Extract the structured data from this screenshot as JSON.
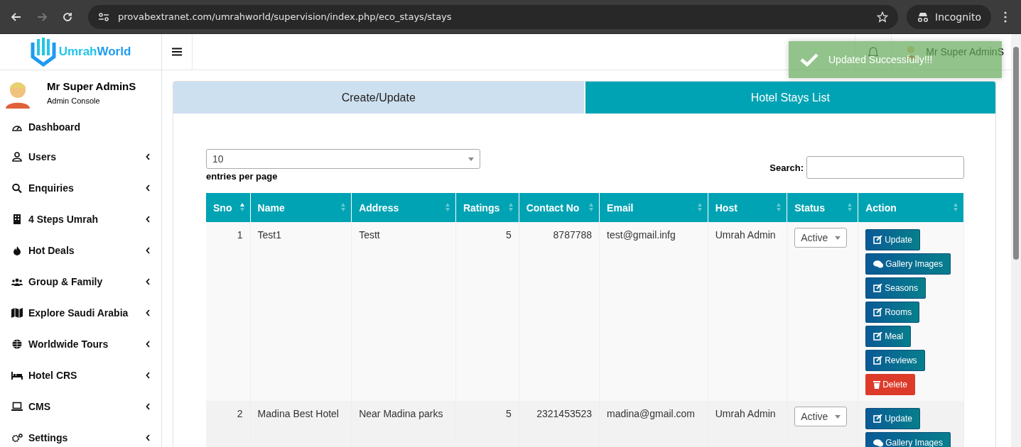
{
  "browser": {
    "url": "provabextranet.com/umrahworld/supervision/index.php/eco_stays/stays",
    "back_disabled": false,
    "forward_disabled": true,
    "profile": "Incognito"
  },
  "logo": {
    "first": "Umrah",
    "second": "World"
  },
  "user": {
    "name": "Mr Super AdminS",
    "role": "Admin Console"
  },
  "sidebar": {
    "items": [
      {
        "label": "Dashboard",
        "has_submenu": false
      },
      {
        "label": "Users",
        "has_submenu": true
      },
      {
        "label": "Enquiries",
        "has_submenu": true
      },
      {
        "label": "4 Steps Umrah",
        "has_submenu": true
      },
      {
        "label": "Hot Deals",
        "has_submenu": true
      },
      {
        "label": "Group & Family",
        "has_submenu": true
      },
      {
        "label": "Explore Saudi Arabia",
        "has_submenu": true
      },
      {
        "label": "Worldwide Tours",
        "has_submenu": true
      },
      {
        "label": "Hotel CRS",
        "has_submenu": true
      },
      {
        "label": "CMS",
        "has_submenu": true
      },
      {
        "label": "Settings",
        "has_submenu": true
      }
    ]
  },
  "header": {
    "user_name": "Mr Super AdminS"
  },
  "toast": {
    "message": "Updated Successfully!!!"
  },
  "tabs": [
    {
      "label": "Create/Update",
      "selected": false
    },
    {
      "label": "Hotel Stays List",
      "selected": true
    }
  ],
  "entries": {
    "value": "10",
    "label": "entries per page"
  },
  "search": {
    "label": "Search:"
  },
  "table": {
    "columns": [
      {
        "label": "Sno",
        "sorted": true
      },
      {
        "label": "Name",
        "sorted": false
      },
      {
        "label": "Address",
        "sorted": false
      },
      {
        "label": "Ratings",
        "sorted": false
      },
      {
        "label": "Contact No",
        "sorted": false
      },
      {
        "label": "Email",
        "sorted": false
      },
      {
        "label": "Host",
        "sorted": false
      },
      {
        "label": "Status",
        "sorted": false
      },
      {
        "label": "Action",
        "sorted": false
      }
    ],
    "rows": [
      {
        "sno": "1",
        "name": "Test1",
        "address": "Testt",
        "ratings": "5",
        "contact": "8787788",
        "email": "test@gmail.infg",
        "host": "Umrah Admin",
        "status": "Active",
        "actions": [
          {
            "label": "Update",
            "kind": "edit"
          },
          {
            "label": "Gallery Images",
            "kind": "gallery"
          },
          {
            "label": "Seasons",
            "kind": "edit"
          },
          {
            "label": "Rooms",
            "kind": "edit"
          },
          {
            "label": "Meal",
            "kind": "edit"
          },
          {
            "label": "Reviews",
            "kind": "edit"
          },
          {
            "label": "Delete",
            "kind": "delete"
          }
        ]
      },
      {
        "sno": "2",
        "name": "Madina Best Hotel",
        "address": "Near Madina parks",
        "ratings": "5",
        "contact": "2321453523",
        "email": "madina@gmail.com",
        "host": "Umrah Admin",
        "status": "Active",
        "actions": [
          {
            "label": "Update",
            "kind": "edit"
          },
          {
            "label": "Gallery Images",
            "kind": "gallery"
          }
        ]
      }
    ]
  }
}
